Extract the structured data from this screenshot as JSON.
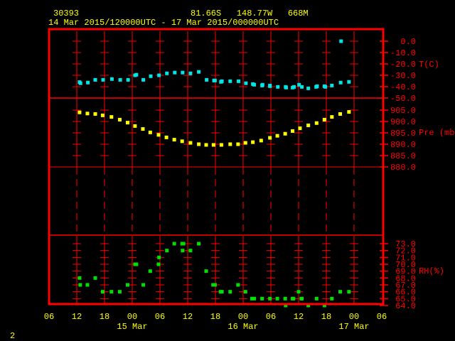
{
  "header": {
    "station_id": "30393",
    "location": "81.66S   148.77W   668M",
    "time_range": "14 Mar 2015/120000UTC - 17 Mar 2015/000000UTC"
  },
  "page_number": "2",
  "colors": {
    "frame": "#ff0000",
    "text": "#ffff00",
    "temperature": "#00e5e5",
    "pressure": "#ffff00",
    "rh": "#00e000"
  },
  "chart_data": [
    {
      "type": "scatter",
      "title": "Temperature",
      "ylabel": "T(C)",
      "x_units": "hours since 14 Mar 2015 12UTC",
      "ylim": [
        -50,
        0
      ],
      "yticks": [
        "0.0",
        "-10.0",
        "-20.0",
        "-30.0",
        "-40.0",
        "-50.0"
      ],
      "ytick_values": [
        0,
        -10,
        -20,
        -30,
        -40,
        -50
      ],
      "x": [
        0.6,
        0.8,
        2.4,
        4.0,
        5.7,
        7.6,
        9.4,
        11.1,
        12.6,
        12.9,
        14.4,
        16.0,
        17.8,
        19.5,
        21.2,
        22.9,
        24.6,
        26.4,
        28.1,
        29.7,
        29.9,
        31.2,
        31.4,
        33.2,
        35.0,
        36.6,
        38.1,
        38.4,
        40.1,
        40.2,
        41.8,
        41.8,
        43.5,
        45.2,
        45.3,
        46.7,
        47.0,
        48.1,
        48.7,
        50.1,
        51.8,
        52.0,
        53.6,
        53.8,
        55.2,
        57.1,
        58.9,
        57.2
      ],
      "y": [
        -36,
        -37,
        -36.4,
        -34,
        -34,
        -33.3,
        -34,
        -34,
        -30,
        -29.5,
        -34,
        -30.8,
        -30,
        -28.3,
        -27.6,
        -27.6,
        -28.3,
        -27,
        -34,
        -34.6,
        -34.6,
        -35.8,
        -35.2,
        -35.2,
        -35.2,
        -37,
        -37.7,
        -38.3,
        -39,
        -38.3,
        -39,
        -39.6,
        -40.2,
        -40.2,
        -40.8,
        -40.8,
        -40.2,
        -38.3,
        -40.2,
        -41.5,
        -40.2,
        -39.6,
        -39.6,
        -40.2,
        -39,
        -36.4,
        -35.8,
        0
      ]
    },
    {
      "type": "scatter",
      "title": "Pressure",
      "ylabel": "Pre (mb)",
      "x_units": "hours since 14 Mar 2015 12UTC",
      "ylim": [
        880,
        905
      ],
      "yticks": [
        "905.0",
        "900.0",
        "895.0",
        "890.0",
        "885.0",
        "880.0"
      ],
      "ytick_values": [
        905,
        900,
        895,
        890,
        885,
        880
      ],
      "x": [
        0.6,
        2.3,
        4.0,
        5.6,
        7.5,
        9.3,
        11.0,
        12.6,
        14.3,
        15.9,
        17.7,
        19.4,
        21.1,
        22.8,
        24.6,
        26.4,
        28.0,
        29.6,
        31.3,
        33.2,
        34.9,
        36.5,
        38.1,
        39.9,
        41.8,
        43.4,
        45.1,
        46.7,
        48.3,
        50.1,
        51.9,
        53.6,
        55.2,
        57.0,
        58.9
      ],
      "y": [
        904.0,
        903.5,
        903.3,
        902.7,
        902.0,
        900.8,
        899.5,
        898.0,
        896.7,
        895.2,
        894.1,
        893.0,
        892.0,
        891.3,
        890.6,
        890.0,
        889.7,
        889.7,
        889.7,
        890.0,
        890.0,
        890.6,
        890.9,
        891.6,
        892.8,
        893.7,
        894.6,
        895.8,
        897.0,
        898.3,
        899.3,
        900.8,
        902.0,
        903.3,
        904.2
      ]
    },
    {
      "type": "scatter",
      "title": "Relative Humidity",
      "ylabel": "RH(%)",
      "x_units": "hours since 14 Mar 2015 12UTC",
      "ylim": [
        64,
        73
      ],
      "yticks": [
        "73.0",
        "72.0",
        "71.0",
        "70.0",
        "69.0",
        "68.0",
        "67.0",
        "66.0",
        "65.0",
        "64.0"
      ],
      "ytick_values": [
        73,
        72,
        71,
        70,
        69,
        68,
        67,
        66,
        65,
        64
      ],
      "x": [
        0.6,
        0.75,
        2.3,
        4.0,
        5.6,
        7.5,
        9.3,
        11.0,
        12.6,
        12.9,
        14.4,
        15.9,
        17.7,
        17.8,
        19.5,
        21.1,
        22.8,
        23.1,
        22.9,
        24.6,
        26.4,
        28.0,
        29.5,
        29.9,
        31.1,
        31.4,
        33.2,
        34.9,
        36.5,
        37.9,
        38.4,
        40.1,
        41.8,
        43.4,
        45.1,
        45.2,
        46.7,
        46.9,
        48.0,
        48.6,
        48.7,
        50.1,
        51.9,
        53.6,
        55.2,
        57.0,
        58.9
      ],
      "y": [
        68,
        67,
        67,
        68,
        66,
        66,
        66,
        67,
        70,
        70,
        67,
        69,
        70,
        71,
        72,
        73,
        73,
        73,
        72,
        72,
        73,
        69,
        67,
        67,
        66,
        66,
        66,
        67,
        66,
        65,
        65,
        65,
        65,
        65,
        65,
        64,
        65,
        65,
        66,
        65,
        65,
        64,
        65,
        64,
        65,
        66,
        66
      ]
    }
  ],
  "x_axis": {
    "hour_labels": [
      "06",
      "12",
      "18",
      "00",
      "06",
      "12",
      "18",
      "00",
      "06",
      "12",
      "18",
      "00",
      "06"
    ],
    "date_labels": [
      "15 Mar",
      "16 Mar",
      "17 Mar"
    ]
  }
}
